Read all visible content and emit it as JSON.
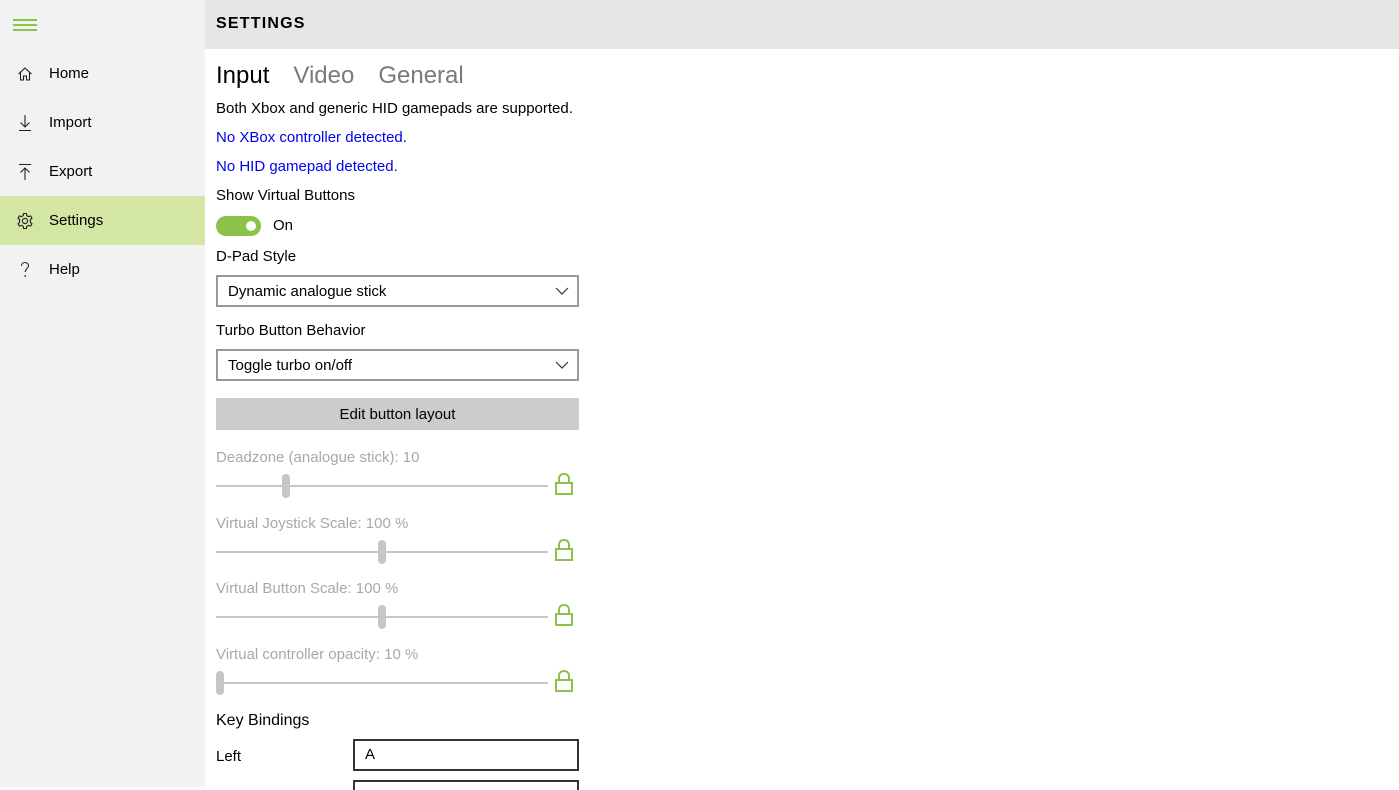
{
  "app": {
    "header_title": "SETTINGS",
    "accent_color": "#8bc34a",
    "selected_nav_bg": "#d4e6a4"
  },
  "sidebar": {
    "menu_icon": "hamburger-icon",
    "items": [
      {
        "label": "Home",
        "icon": "home-icon"
      },
      {
        "label": "Import",
        "icon": "import-icon"
      },
      {
        "label": "Export",
        "icon": "export-icon"
      },
      {
        "label": "Settings",
        "icon": "gear-icon",
        "selected": true
      },
      {
        "label": "Help",
        "icon": "help-icon"
      }
    ]
  },
  "tabs": [
    {
      "label": "Input",
      "active": true
    },
    {
      "label": "Video",
      "active": false
    },
    {
      "label": "General",
      "active": false
    }
  ],
  "input": {
    "support_text": "Both Xbox and generic HID gamepads are supported.",
    "xbox_status": "No XBox controller detected.",
    "hid_status": "No HID gamepad detected.",
    "virtual_buttons_label": "Show Virtual Buttons",
    "virtual_buttons_state": "On",
    "dpad_label": "D-Pad Style",
    "dpad_value": "Dynamic analogue stick",
    "turbo_label": "Turbo Button Behavior",
    "turbo_value": "Toggle turbo on/off",
    "edit_layout_button": "Edit button layout",
    "sliders": [
      {
        "label": "Deadzone (analogue stick):  10",
        "fraction": 0.21
      },
      {
        "label": "Virtual Joystick Scale:  100 %",
        "fraction": 0.5
      },
      {
        "label": "Virtual Button Scale:  100 %",
        "fraction": 0.5
      },
      {
        "label": "Virtual controller opacity:  10 %",
        "fraction": 0.01
      }
    ],
    "key_bindings_title": "Key Bindings",
    "key_bindings": [
      {
        "label": "Left",
        "value": "A"
      }
    ]
  }
}
